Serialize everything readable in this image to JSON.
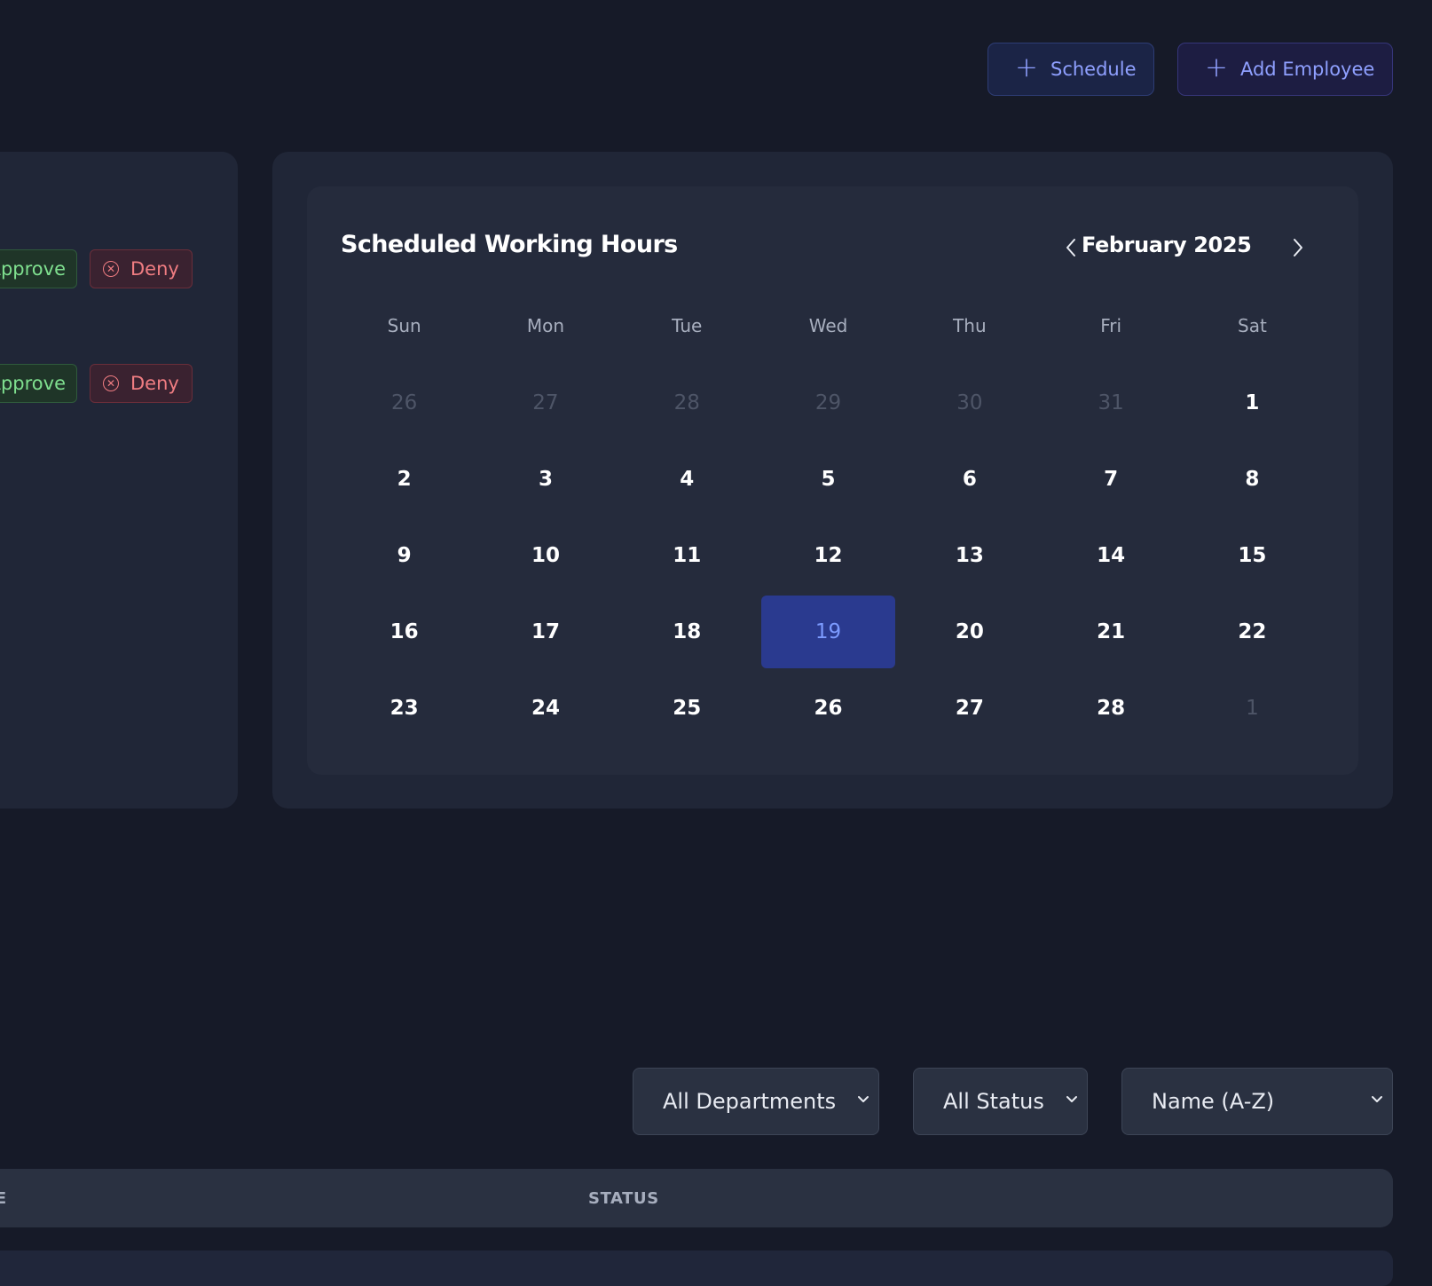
{
  "toolbar": {
    "schedule_label": "Schedule",
    "add_employee_label": "Add Employee"
  },
  "requests": [
    {
      "approve_label": "Approve",
      "deny_label": "Deny"
    },
    {
      "approve_label": "Approve",
      "deny_label": "Deny"
    }
  ],
  "calendar": {
    "title": "Scheduled Working Hours",
    "month_label": "February 2025",
    "weekdays": [
      "Sun",
      "Mon",
      "Tue",
      "Wed",
      "Thu",
      "Fri",
      "Sat"
    ],
    "days": [
      {
        "d": "26",
        "muted": true
      },
      {
        "d": "27",
        "muted": true
      },
      {
        "d": "28",
        "muted": true
      },
      {
        "d": "29",
        "muted": true
      },
      {
        "d": "30",
        "muted": true
      },
      {
        "d": "31",
        "muted": true
      },
      {
        "d": "1"
      },
      {
        "d": "2"
      },
      {
        "d": "3"
      },
      {
        "d": "4"
      },
      {
        "d": "5"
      },
      {
        "d": "6"
      },
      {
        "d": "7"
      },
      {
        "d": "8"
      },
      {
        "d": "9"
      },
      {
        "d": "10"
      },
      {
        "d": "11"
      },
      {
        "d": "12"
      },
      {
        "d": "13"
      },
      {
        "d": "14"
      },
      {
        "d": "15"
      },
      {
        "d": "16"
      },
      {
        "d": "17"
      },
      {
        "d": "18"
      },
      {
        "d": "19",
        "today": true
      },
      {
        "d": "20"
      },
      {
        "d": "21"
      },
      {
        "d": "22"
      },
      {
        "d": "23"
      },
      {
        "d": "24"
      },
      {
        "d": "25"
      },
      {
        "d": "26"
      },
      {
        "d": "27"
      },
      {
        "d": "28"
      },
      {
        "d": "1",
        "muted": true
      }
    ]
  },
  "filters": {
    "department": "All Departments",
    "status": "All Status",
    "sort": "Name (A-Z)"
  },
  "table": {
    "headers": [
      "TE",
      "STATUS"
    ]
  },
  "colors": {
    "background": "#161a28",
    "card": "#202637",
    "accent": "#8fa0ff",
    "today_bg": "#2a3a8f",
    "approve": "#7fe08f",
    "deny": "#f07d82"
  }
}
